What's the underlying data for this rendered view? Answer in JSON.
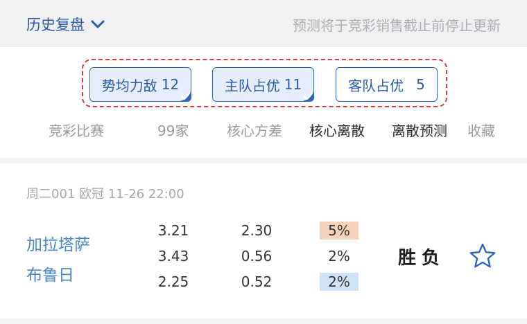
{
  "header": {
    "history_label": "历史复盘",
    "notice": "预测将于竞彩销售截止前停止更新"
  },
  "filters": {
    "chips": [
      {
        "label": "势均力敌",
        "count": "12",
        "checked": true
      },
      {
        "label": "主队占优",
        "count": "11",
        "checked": true
      },
      {
        "label": "客队占优",
        "count": "5",
        "checked": false
      }
    ]
  },
  "columns": [
    "竞彩比赛",
    "99家",
    "核心方差",
    "核心离散",
    "离散预测",
    "收藏"
  ],
  "match": {
    "meta": "周二001 欧冠 11-26 22:00",
    "home": "加拉塔萨",
    "away": "布鲁日",
    "odds": [
      "3.21",
      "3.43",
      "2.25"
    ],
    "variance": [
      "2.30",
      "0.56",
      "0.52"
    ],
    "dispersion": [
      "5%",
      "2%",
      "2%"
    ],
    "prediction": "胜负"
  },
  "colors": {
    "accent": "#2a5aa8",
    "dash_border": "#d9393a",
    "hot": "#f8d3bb",
    "cold": "#cfe2f8"
  },
  "icons": [
    "chevron-down-icon",
    "checkmark-icon",
    "star-outline-icon"
  ]
}
